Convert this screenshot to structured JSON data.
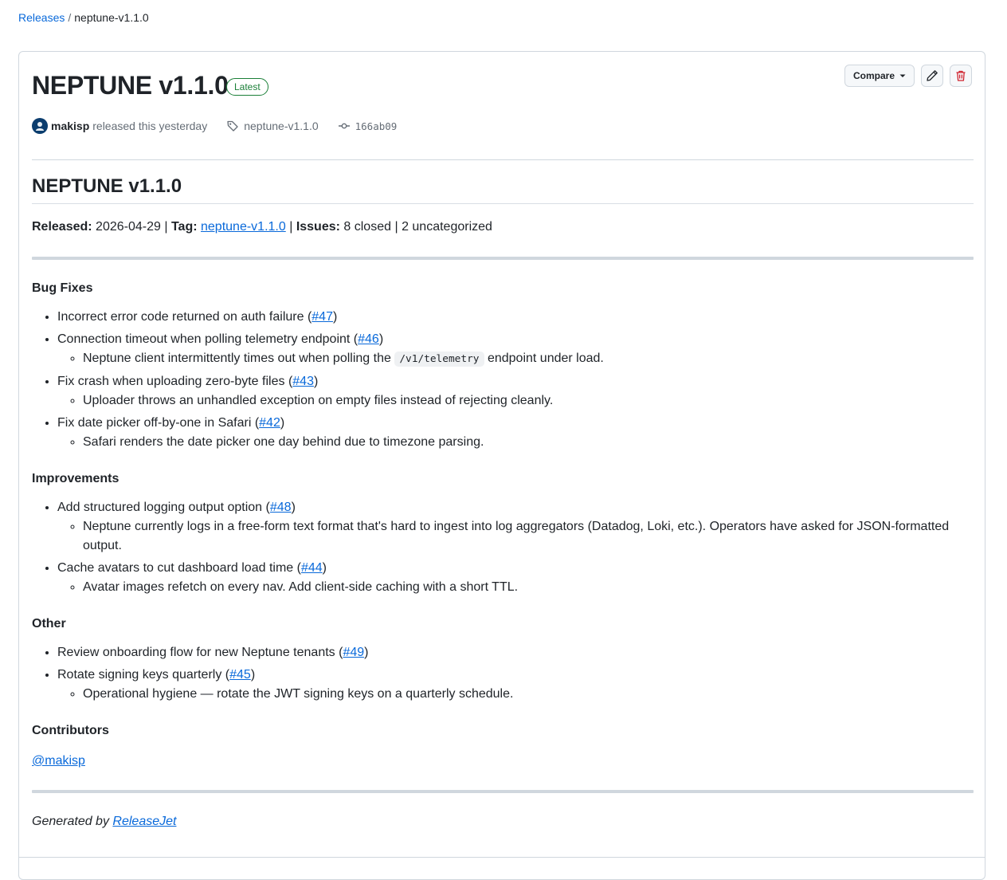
{
  "breadcrumb": {
    "root": "Releases",
    "separator": "/",
    "current": "neptune-v1.1.0"
  },
  "release": {
    "title": "NEPTUNE v1.1.0",
    "badge": "Latest",
    "compare_label": "Compare",
    "author": "makisp",
    "released_text": "released this yesterday",
    "tag": "neptune-v1.1.0",
    "commit": "166ab09"
  },
  "notes": {
    "heading": "NEPTUNE v1.1.0",
    "summary": {
      "released_label": "Released:",
      "released_value": "2026-04-29",
      "sep1": "|",
      "tag_label": "Tag:",
      "tag_value": "neptune-v1.1.0",
      "sep2": "|",
      "issues_label": "Issues:",
      "issues_value": "8 closed",
      "sep3": "|",
      "uncategorized": "2 uncategorized"
    },
    "bug_fixes": {
      "title": "Bug Fixes",
      "items": [
        {
          "text": "Incorrect error code returned on auth failure",
          "issue": "#47",
          "detail": ""
        },
        {
          "text": "Connection timeout when polling telemetry endpoint",
          "issue": "#46",
          "detail_pre": "Neptune client intermittently times out when polling the",
          "detail_code": "/v1/telemetry",
          "detail_post": "endpoint under load."
        },
        {
          "text": "Fix crash when uploading zero-byte files",
          "issue": "#43",
          "detail": "Uploader throws an unhandled exception on empty files instead of rejecting cleanly."
        },
        {
          "text": "Fix date picker off-by-one in Safari",
          "issue": "#42",
          "detail": "Safari renders the date picker one day behind due to timezone parsing."
        }
      ]
    },
    "improvements": {
      "title": "Improvements",
      "items": [
        {
          "text": "Add structured logging output option",
          "issue": "#48",
          "detail": "Neptune currently logs in a free-form text format that's hard to ingest into log aggregators (Datadog, Loki, etc.). Operators have asked for JSON-formatted output."
        },
        {
          "text": "Cache avatars to cut dashboard load time",
          "issue": "#44",
          "detail": "Avatar images refetch on every nav. Add client-side caching with a short TTL."
        }
      ]
    },
    "other": {
      "title": "Other",
      "items": [
        {
          "text": "Review onboarding flow for new Neptune tenants",
          "issue": "#49",
          "detail": ""
        },
        {
          "text": "Rotate signing keys quarterly",
          "issue": "#45",
          "detail": "Operational hygiene — rotate the JWT signing keys on a quarterly schedule."
        }
      ]
    },
    "contributors": {
      "title": "Contributors",
      "handle": "@makisp"
    },
    "footer": {
      "prefix": "Generated by",
      "link": "ReleaseJet"
    }
  },
  "paren_open": "(",
  "paren_close": ")"
}
